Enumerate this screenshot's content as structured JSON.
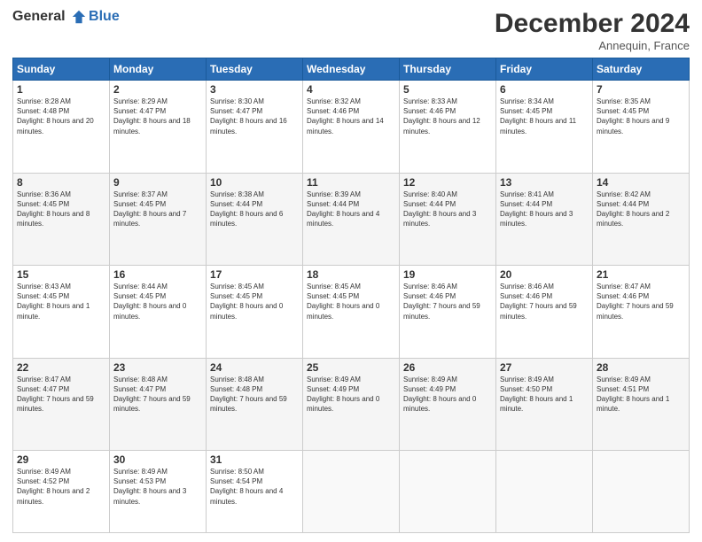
{
  "header": {
    "logo_line1": "General",
    "logo_line2": "Blue",
    "month_title": "December 2024",
    "location": "Annequin, France"
  },
  "days_of_week": [
    "Sunday",
    "Monday",
    "Tuesday",
    "Wednesday",
    "Thursday",
    "Friday",
    "Saturday"
  ],
  "weeks": [
    [
      {
        "day": "1",
        "sunrise": "8:28 AM",
        "sunset": "4:48 PM",
        "daylight": "8 hours and 20 minutes."
      },
      {
        "day": "2",
        "sunrise": "8:29 AM",
        "sunset": "4:47 PM",
        "daylight": "8 hours and 18 minutes."
      },
      {
        "day": "3",
        "sunrise": "8:30 AM",
        "sunset": "4:47 PM",
        "daylight": "8 hours and 16 minutes."
      },
      {
        "day": "4",
        "sunrise": "8:32 AM",
        "sunset": "4:46 PM",
        "daylight": "8 hours and 14 minutes."
      },
      {
        "day": "5",
        "sunrise": "8:33 AM",
        "sunset": "4:46 PM",
        "daylight": "8 hours and 12 minutes."
      },
      {
        "day": "6",
        "sunrise": "8:34 AM",
        "sunset": "4:45 PM",
        "daylight": "8 hours and 11 minutes."
      },
      {
        "day": "7",
        "sunrise": "8:35 AM",
        "sunset": "4:45 PM",
        "daylight": "8 hours and 9 minutes."
      }
    ],
    [
      {
        "day": "8",
        "sunrise": "8:36 AM",
        "sunset": "4:45 PM",
        "daylight": "8 hours and 8 minutes."
      },
      {
        "day": "9",
        "sunrise": "8:37 AM",
        "sunset": "4:45 PM",
        "daylight": "8 hours and 7 minutes."
      },
      {
        "day": "10",
        "sunrise": "8:38 AM",
        "sunset": "4:44 PM",
        "daylight": "8 hours and 6 minutes."
      },
      {
        "day": "11",
        "sunrise": "8:39 AM",
        "sunset": "4:44 PM",
        "daylight": "8 hours and 4 minutes."
      },
      {
        "day": "12",
        "sunrise": "8:40 AM",
        "sunset": "4:44 PM",
        "daylight": "8 hours and 3 minutes."
      },
      {
        "day": "13",
        "sunrise": "8:41 AM",
        "sunset": "4:44 PM",
        "daylight": "8 hours and 3 minutes."
      },
      {
        "day": "14",
        "sunrise": "8:42 AM",
        "sunset": "4:44 PM",
        "daylight": "8 hours and 2 minutes."
      }
    ],
    [
      {
        "day": "15",
        "sunrise": "8:43 AM",
        "sunset": "4:45 PM",
        "daylight": "8 hours and 1 minute."
      },
      {
        "day": "16",
        "sunrise": "8:44 AM",
        "sunset": "4:45 PM",
        "daylight": "8 hours and 0 minutes."
      },
      {
        "day": "17",
        "sunrise": "8:45 AM",
        "sunset": "4:45 PM",
        "daylight": "8 hours and 0 minutes."
      },
      {
        "day": "18",
        "sunrise": "8:45 AM",
        "sunset": "4:45 PM",
        "daylight": "8 hours and 0 minutes."
      },
      {
        "day": "19",
        "sunrise": "8:46 AM",
        "sunset": "4:46 PM",
        "daylight": "7 hours and 59 minutes."
      },
      {
        "day": "20",
        "sunrise": "8:46 AM",
        "sunset": "4:46 PM",
        "daylight": "7 hours and 59 minutes."
      },
      {
        "day": "21",
        "sunrise": "8:47 AM",
        "sunset": "4:46 PM",
        "daylight": "7 hours and 59 minutes."
      }
    ],
    [
      {
        "day": "22",
        "sunrise": "8:47 AM",
        "sunset": "4:47 PM",
        "daylight": "7 hours and 59 minutes."
      },
      {
        "day": "23",
        "sunrise": "8:48 AM",
        "sunset": "4:47 PM",
        "daylight": "7 hours and 59 minutes."
      },
      {
        "day": "24",
        "sunrise": "8:48 AM",
        "sunset": "4:48 PM",
        "daylight": "7 hours and 59 minutes."
      },
      {
        "day": "25",
        "sunrise": "8:49 AM",
        "sunset": "4:49 PM",
        "daylight": "8 hours and 0 minutes."
      },
      {
        "day": "26",
        "sunrise": "8:49 AM",
        "sunset": "4:49 PM",
        "daylight": "8 hours and 0 minutes."
      },
      {
        "day": "27",
        "sunrise": "8:49 AM",
        "sunset": "4:50 PM",
        "daylight": "8 hours and 1 minute."
      },
      {
        "day": "28",
        "sunrise": "8:49 AM",
        "sunset": "4:51 PM",
        "daylight": "8 hours and 1 minute."
      }
    ],
    [
      {
        "day": "29",
        "sunrise": "8:49 AM",
        "sunset": "4:52 PM",
        "daylight": "8 hours and 2 minutes."
      },
      {
        "day": "30",
        "sunrise": "8:49 AM",
        "sunset": "4:53 PM",
        "daylight": "8 hours and 3 minutes."
      },
      {
        "day": "31",
        "sunrise": "8:50 AM",
        "sunset": "4:54 PM",
        "daylight": "8 hours and 4 minutes."
      },
      null,
      null,
      null,
      null
    ]
  ]
}
